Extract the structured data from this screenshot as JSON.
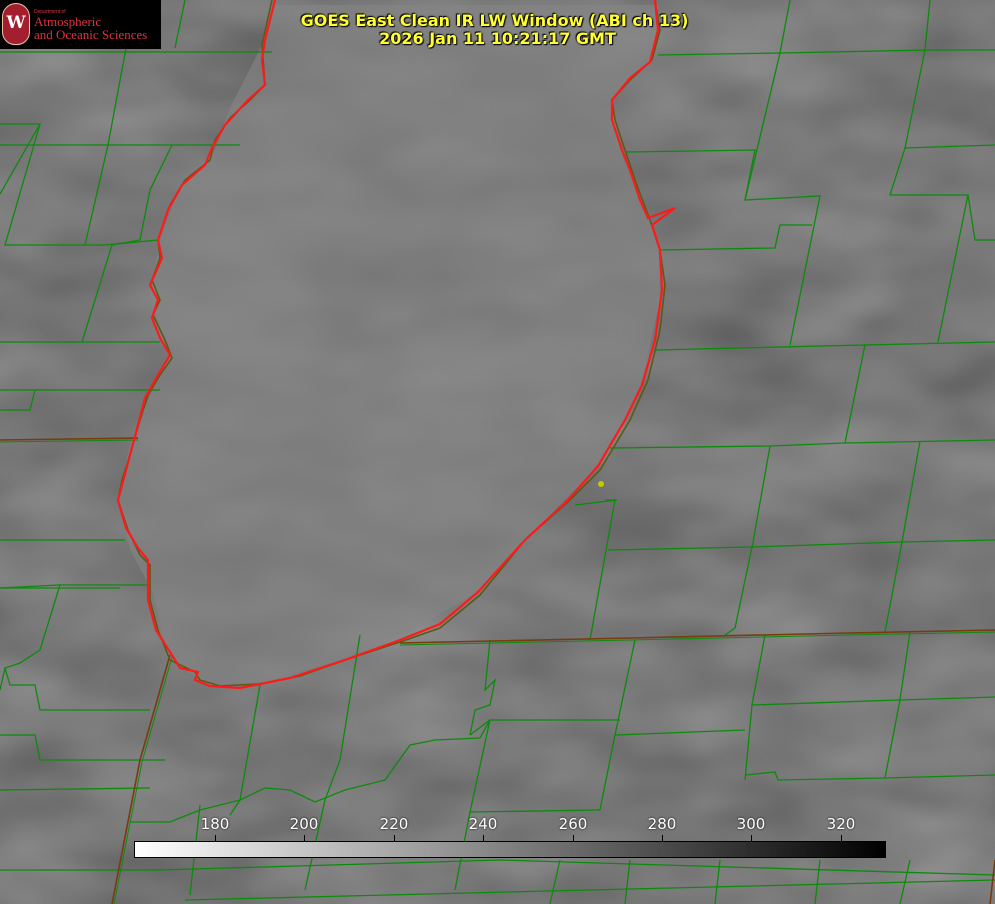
{
  "title": {
    "line1": "GOES East Clean IR LW Window (ABI ch 13)",
    "line2": "2026 Jan 11 10:21:17 GMT"
  },
  "logo": {
    "small_text": "Department of",
    "line1": "Atmospheric",
    "line2": "and Oceanic Sciences",
    "seal_letter": "W"
  },
  "colorbar": {
    "ticks": [
      "180",
      "200",
      "220",
      "240",
      "260",
      "280",
      "300",
      "320"
    ],
    "min_color": "#ffffff",
    "max_color": "#000000"
  },
  "colors": {
    "county_lines": "#0d8a0d",
    "state_lines": "#7a3a10",
    "lake_outline": "#ff1a1a",
    "marker": "#c8c800",
    "background_gray": "#7b7b7b"
  }
}
